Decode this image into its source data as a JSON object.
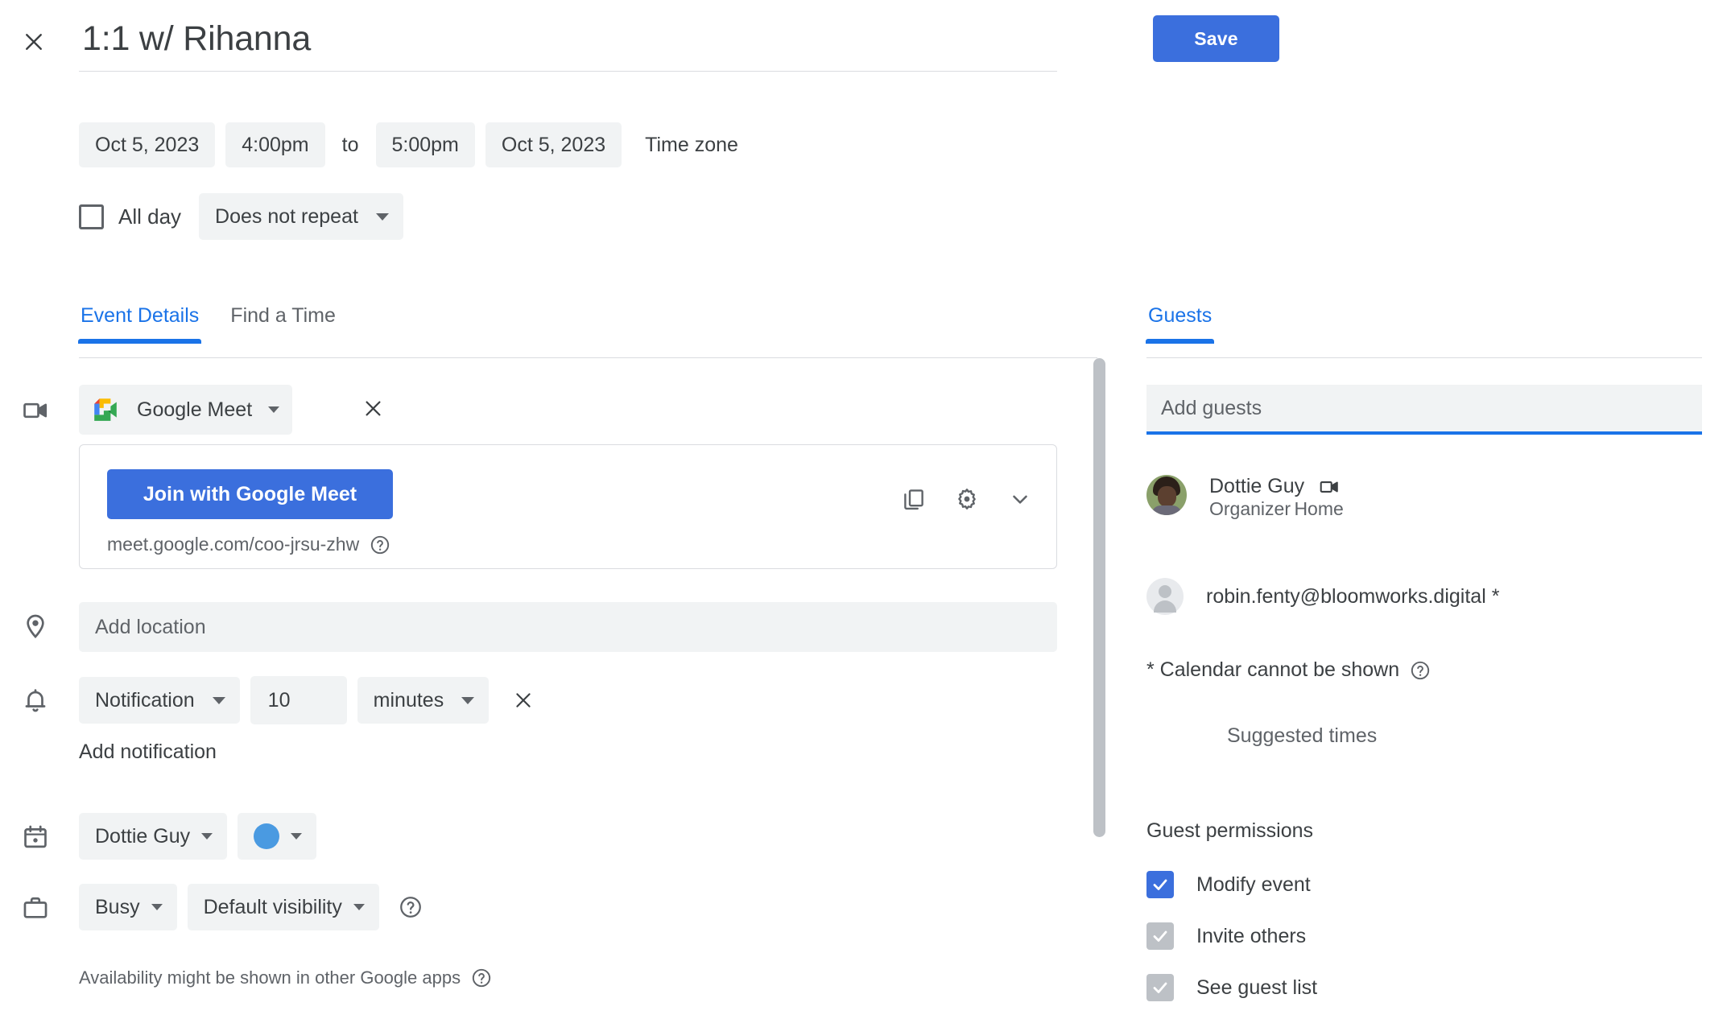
{
  "header": {
    "close_icon": "close-icon",
    "title": "1:1 w/ Rihanna",
    "save_label": "Save"
  },
  "datetime": {
    "start_date": "Oct 5, 2023",
    "start_time": "4:00pm",
    "to_label": "to",
    "end_time": "5:00pm",
    "end_date": "Oct 5, 2023",
    "timezone_label": "Time zone",
    "all_day_label": "All day",
    "all_day_checked": false,
    "repeat_value": "Does not repeat"
  },
  "tabs": [
    {
      "label": "Event Details",
      "active": true
    },
    {
      "label": "Find a Time",
      "active": false
    }
  ],
  "main": {
    "conference": {
      "icon": "video-camera-icon",
      "provider": "Google Meet",
      "remove_icon": "close-icon",
      "join_label": "Join with Google Meet",
      "url": "meet.google.com/coo-jrsu-zhw",
      "url_help_icon": "help-icon",
      "copy_icon": "copy-icon",
      "settings_icon": "gear-icon",
      "expand_icon": "chevron-down-icon"
    },
    "location": {
      "icon": "location-pin-icon",
      "placeholder": "Add location",
      "value": ""
    },
    "notification": {
      "icon": "bell-icon",
      "type": "Notification",
      "amount": "10",
      "unit": "minutes",
      "remove_icon": "close-icon",
      "add_label": "Add notification"
    },
    "calendar": {
      "icon": "calendar-icon",
      "owner": "Dottie Guy",
      "color_hex": "#4a9ae1"
    },
    "availability": {
      "icon": "briefcase-icon",
      "busy": "Busy",
      "visibility": "Default visibility",
      "help_icon": "help-icon",
      "note": "Availability might be shown in other Google apps",
      "note_help_icon": "help-icon"
    }
  },
  "guests": {
    "tab_label": "Guests",
    "add_placeholder": "Add guests",
    "add_value": "",
    "list": [
      {
        "name": "Dottie Guy",
        "video_icon": "video-camera-icon",
        "role": "Organizer",
        "calendar": "Home",
        "avatar": "photo-avatar"
      },
      {
        "name": "robin.fenty@bloomworks.digital *",
        "role": "",
        "calendar": "",
        "avatar": "generic-avatar"
      }
    ],
    "calendar_warning": "* Calendar cannot be shown",
    "calendar_warning_help_icon": "help-icon",
    "suggested_times_label": "Suggested times",
    "permissions_title": "Guest permissions",
    "permissions": [
      {
        "label": "Modify event",
        "checked": true,
        "enabled": true
      },
      {
        "label": "Invite others",
        "checked": true,
        "enabled": false
      },
      {
        "label": "See guest list",
        "checked": true,
        "enabled": false
      }
    ]
  },
  "colors": {
    "accent": "#1a73e8",
    "button": "#3b6fdd",
    "chip_bg": "#f1f3f4",
    "text": "#3c4043",
    "muted": "#5f6368"
  }
}
